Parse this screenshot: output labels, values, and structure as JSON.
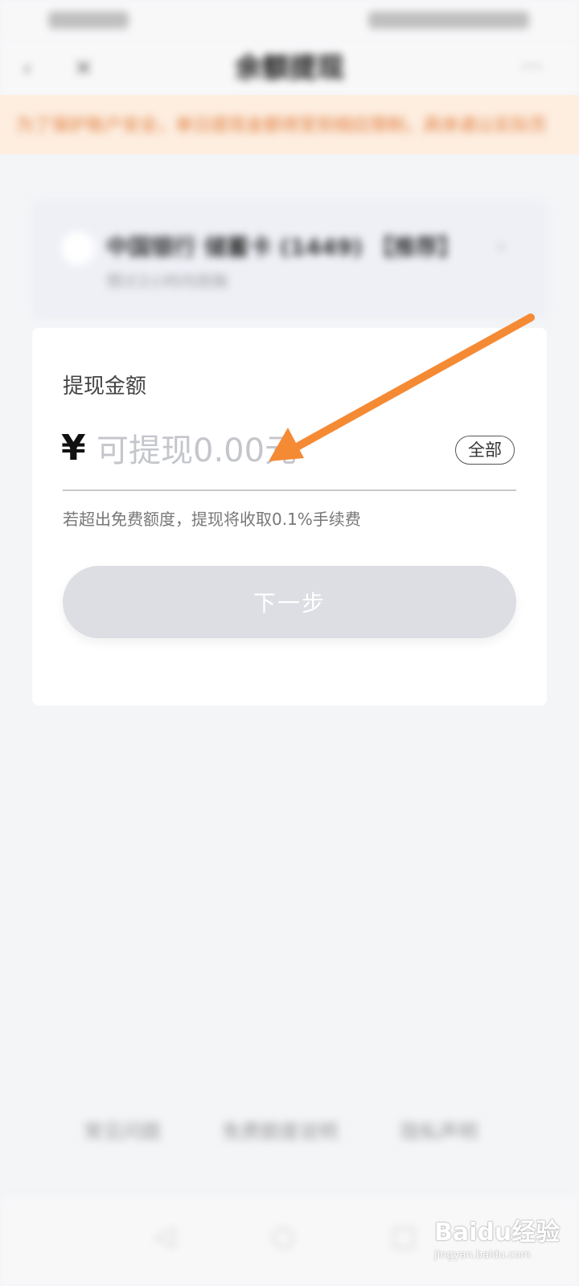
{
  "status_bar": {},
  "nav": {
    "back_icon": "chevron-left-icon",
    "close_icon": "close-icon",
    "title": "余额提现",
    "more_icon": "more-icon"
  },
  "notice": {
    "text": "为了保护账户安全，单日提现金额将受到相应限制，具体请以实际页面为准"
  },
  "bank_card": {
    "name": "中国银行 储蓄卡 (1449) 【推荐】",
    "subtext": "预计2小时内到账"
  },
  "form": {
    "title": "提现金额",
    "currency_symbol": "¥",
    "amount_value": "",
    "amount_placeholder": "可提现0.00元",
    "all_label": "全部",
    "hint": "若超出免费额度，提现将收取0.1%手续费",
    "next_label": "下一步"
  },
  "footer": {
    "links": [
      "常见问题",
      "免费额度说明",
      "隐私声明"
    ]
  },
  "annotation": {
    "arrow_color": "#f58a35"
  },
  "watermark": {
    "main": "Baidu经验",
    "sub": "jingyan.baidu.com"
  }
}
